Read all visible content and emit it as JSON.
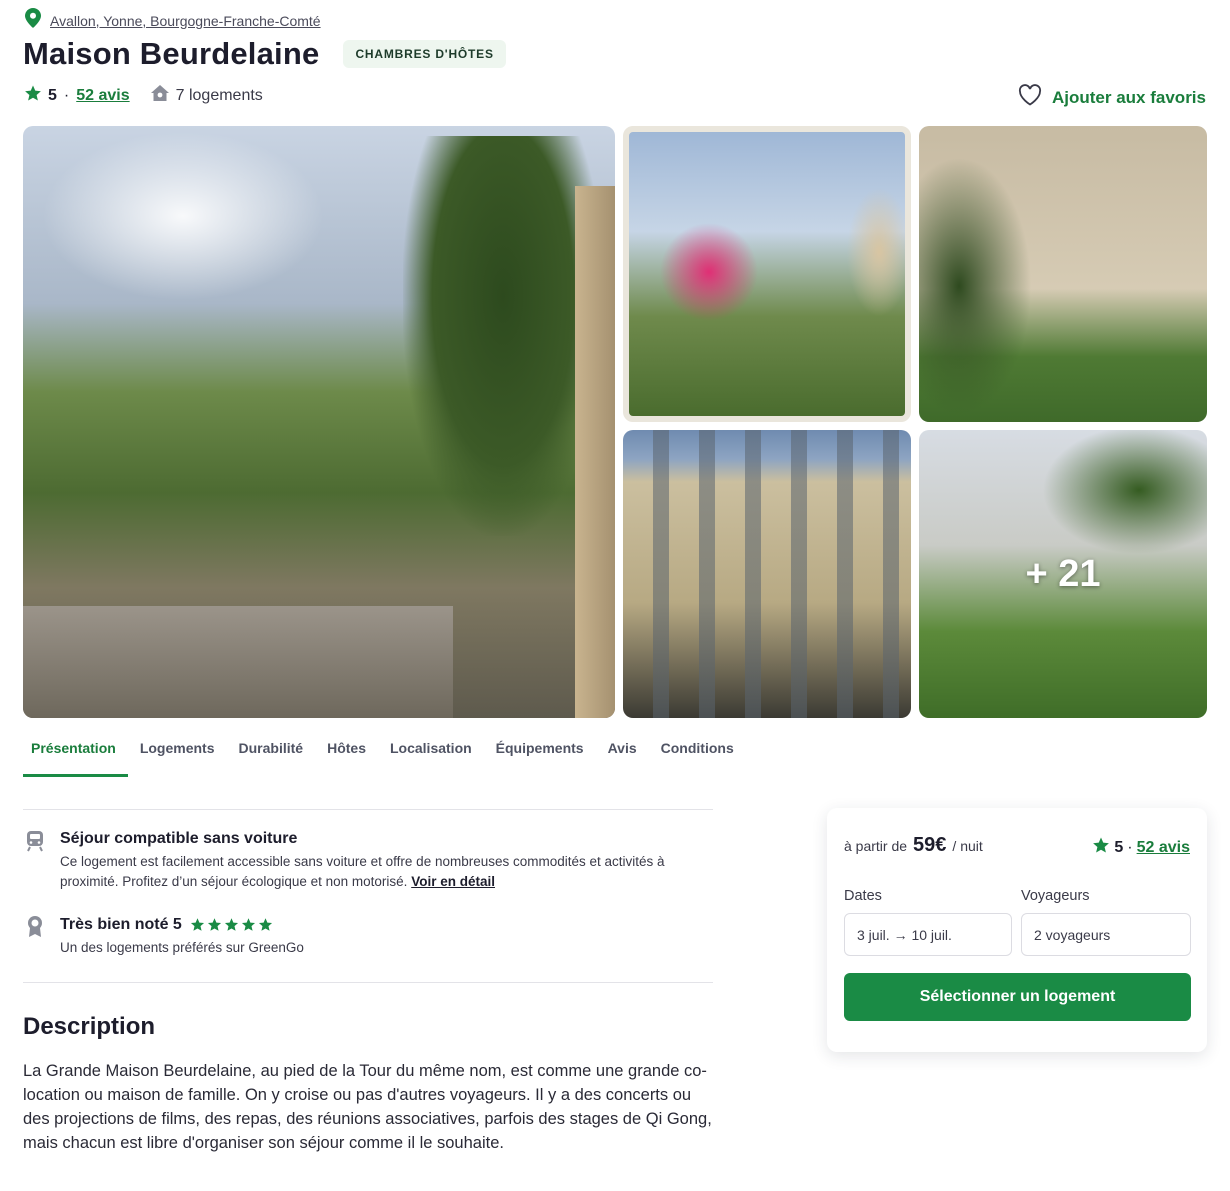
{
  "location": {
    "label": "Avallon, Yonne, Bourgogne-Franche-Comté"
  },
  "header": {
    "title": "Maison Beurdelaine",
    "badge": "CHAMBRES D'HÔTES",
    "rating": "5",
    "separator": "·",
    "reviews": "52 avis",
    "lodgings": "7 logements",
    "favorite": "Ajouter aux favoris"
  },
  "gallery": {
    "more_count": "+ 21"
  },
  "tabs": [
    {
      "label": "Présentation",
      "active": true
    },
    {
      "label": "Logements"
    },
    {
      "label": "Durabilité"
    },
    {
      "label": "Hôtes"
    },
    {
      "label": "Localisation"
    },
    {
      "label": "Équipements"
    },
    {
      "label": "Avis"
    },
    {
      "label": "Conditions"
    }
  ],
  "features": [
    {
      "icon": "train-icon",
      "title": "Séjour compatible sans voiture",
      "text": "Ce logement est facilement accessible sans voiture et offre de nombreuses commodités et activités à proximité. Profitez d’un séjour écologique et non motorisé.",
      "link": "Voir en détail"
    },
    {
      "icon": "award-icon",
      "title": "Très bien noté 5",
      "stars": 5,
      "text": "Un des logements préférés sur GreenGo"
    }
  ],
  "description": {
    "title": "Description",
    "text": "La Grande Maison Beurdelaine, au pied de la Tour du même nom, est comme une grande co-location ou maison de famille. On y croise ou pas d'autres voyageurs. Il y a des concerts ou des projections de films, des repas, des réunions associatives, parfois des stages de Qi Gong, mais chacun est libre d'organiser son séjour comme il le souhaite."
  },
  "booking": {
    "from": "à partir de",
    "price": "59€",
    "per": "/ nuit",
    "rating": "5",
    "separator": "·",
    "reviews": "52 avis",
    "dates_label": "Dates",
    "dates_value": "3 juil. → 10 juil.",
    "guests_label": "Voyageurs",
    "guests_value": "2 voyageurs",
    "cta": "Sélectionner un logement"
  },
  "colors": {
    "accent": "#1a8b45",
    "accent_text": "#1a7d3c",
    "text": "#1d1d2c",
    "badge_bg": "#eef6ef"
  }
}
